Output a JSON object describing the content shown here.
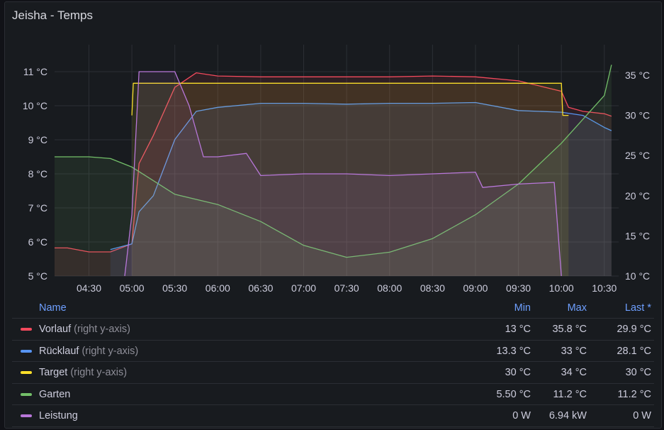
{
  "panel": {
    "title": "Jeisha - Temps"
  },
  "legend": {
    "headers": {
      "name": "Name",
      "min": "Min",
      "max": "Max",
      "last": "Last *"
    },
    "rows": [
      {
        "name": "Vorlauf",
        "axis_note": "(right y-axis)",
        "min": "13 °C",
        "max": "35.8 °C",
        "last": "29.9 °C",
        "color": "#f2495c"
      },
      {
        "name": "Rücklauf",
        "axis_note": "(right y-axis)",
        "min": "13.3 °C",
        "max": "33 °C",
        "last": "28.1 °C",
        "color": "#5794f2"
      },
      {
        "name": "Target",
        "axis_note": "(right y-axis)",
        "min": "30 °C",
        "max": "34 °C",
        "last": "30 °C",
        "color": "#fade2a"
      },
      {
        "name": "Garten",
        "axis_note": "",
        "min": "5.50 °C",
        "max": "11.2 °C",
        "last": "11.2 °C",
        "color": "#73bf69"
      },
      {
        "name": "Leistung",
        "axis_note": "",
        "min": "0 W",
        "max": "6.94 kW",
        "last": "0 W",
        "color": "#b877d9"
      }
    ]
  },
  "chart_data": {
    "type": "line",
    "x_ticks": [
      "04:30",
      "05:00",
      "05:30",
      "06:00",
      "06:30",
      "07:00",
      "07:30",
      "08:00",
      "08:30",
      "09:00",
      "09:30",
      "10:00",
      "10:30"
    ],
    "y_left": {
      "ticks": [
        "5 °C",
        "6 °C",
        "7 °C",
        "8 °C",
        "9 °C",
        "10 °C",
        "11 °C"
      ],
      "range": [
        5,
        11
      ]
    },
    "y_right": {
      "ticks": [
        "10 °C",
        "15 °C",
        "20 °C",
        "25 °C",
        "30 °C",
        "35 °C"
      ],
      "range": [
        10,
        35
      ]
    },
    "grid": true,
    "legend_placement": "bottom",
    "series": [
      {
        "name": "Vorlauf",
        "axis": "right",
        "color": "#f2495c",
        "points": [
          [
            "04:06",
            13.5
          ],
          [
            "04:15",
            13.5
          ],
          [
            "04:30",
            13.0
          ],
          [
            "04:45",
            13.0
          ],
          [
            "05:00",
            14.0
          ],
          [
            "05:05",
            24.0
          ],
          [
            "05:15",
            27.5
          ],
          [
            "05:30",
            33.5
          ],
          [
            "05:45",
            35.3
          ],
          [
            "06:00",
            34.9
          ],
          [
            "06:30",
            34.8
          ],
          [
            "07:00",
            34.8
          ],
          [
            "07:30",
            34.8
          ],
          [
            "08:00",
            34.8
          ],
          [
            "08:30",
            34.9
          ],
          [
            "09:00",
            34.8
          ],
          [
            "09:30",
            34.3
          ],
          [
            "10:00",
            33.0
          ],
          [
            "10:05",
            31.0
          ],
          [
            "10:15",
            30.5
          ],
          [
            "10:30",
            30.2
          ],
          [
            "10:35",
            29.9
          ]
        ]
      },
      {
        "name": "Rücklauf",
        "axis": "right",
        "color": "#5794f2",
        "points": [
          [
            "04:45",
            13.3
          ],
          [
            "05:00",
            14.0
          ],
          [
            "05:05",
            18.0
          ],
          [
            "05:15",
            20.0
          ],
          [
            "05:30",
            27.0
          ],
          [
            "05:45",
            30.5
          ],
          [
            "06:00",
            31.0
          ],
          [
            "06:30",
            31.5
          ],
          [
            "07:00",
            31.5
          ],
          [
            "07:30",
            31.4
          ],
          [
            "08:00",
            31.5
          ],
          [
            "08:30",
            31.5
          ],
          [
            "09:00",
            31.6
          ],
          [
            "09:30",
            30.6
          ],
          [
            "10:00",
            30.4
          ],
          [
            "10:15",
            30.0
          ],
          [
            "10:30",
            28.5
          ],
          [
            "10:35",
            28.1
          ]
        ]
      },
      {
        "name": "Target",
        "axis": "right",
        "color": "#fade2a",
        "points": [
          [
            "05:00",
            30.0
          ],
          [
            "05:01",
            34.0
          ],
          [
            "10:00",
            34.0
          ],
          [
            "10:01",
            30.0
          ],
          [
            "10:05",
            30.0
          ]
        ]
      },
      {
        "name": "Garten",
        "axis": "left",
        "color": "#73bf69",
        "points": [
          [
            "04:06",
            8.5
          ],
          [
            "04:15",
            8.5
          ],
          [
            "04:30",
            8.5
          ],
          [
            "04:45",
            8.45
          ],
          [
            "05:00",
            8.2
          ],
          [
            "05:15",
            7.8
          ],
          [
            "05:30",
            7.4
          ],
          [
            "06:00",
            7.1
          ],
          [
            "06:30",
            6.6
          ],
          [
            "07:00",
            5.9
          ],
          [
            "07:30",
            5.55
          ],
          [
            "08:00",
            5.7
          ],
          [
            "08:30",
            6.1
          ],
          [
            "09:00",
            6.8
          ],
          [
            "09:30",
            7.7
          ],
          [
            "10:00",
            8.9
          ],
          [
            "10:30",
            10.3
          ],
          [
            "10:35",
            11.2
          ]
        ]
      },
      {
        "name": "Leistung",
        "axis": "left",
        "color": "#b877d9",
        "unit_note": "plotted on left scale as visual level",
        "points": [
          [
            "04:55",
            5.0
          ],
          [
            "05:00",
            6.8
          ],
          [
            "05:05",
            11.0
          ],
          [
            "05:15",
            11.0
          ],
          [
            "05:30",
            11.0
          ],
          [
            "05:40",
            10.0
          ],
          [
            "05:50",
            8.5
          ],
          [
            "06:00",
            8.5
          ],
          [
            "06:20",
            8.6
          ],
          [
            "06:30",
            7.95
          ],
          [
            "07:00",
            8.0
          ],
          [
            "07:30",
            8.0
          ],
          [
            "08:00",
            7.95
          ],
          [
            "08:30",
            8.0
          ],
          [
            "09:00",
            8.05
          ],
          [
            "09:05",
            7.6
          ],
          [
            "09:30",
            7.7
          ],
          [
            "09:55",
            7.75
          ],
          [
            "10:00",
            5.0
          ]
        ]
      }
    ]
  }
}
